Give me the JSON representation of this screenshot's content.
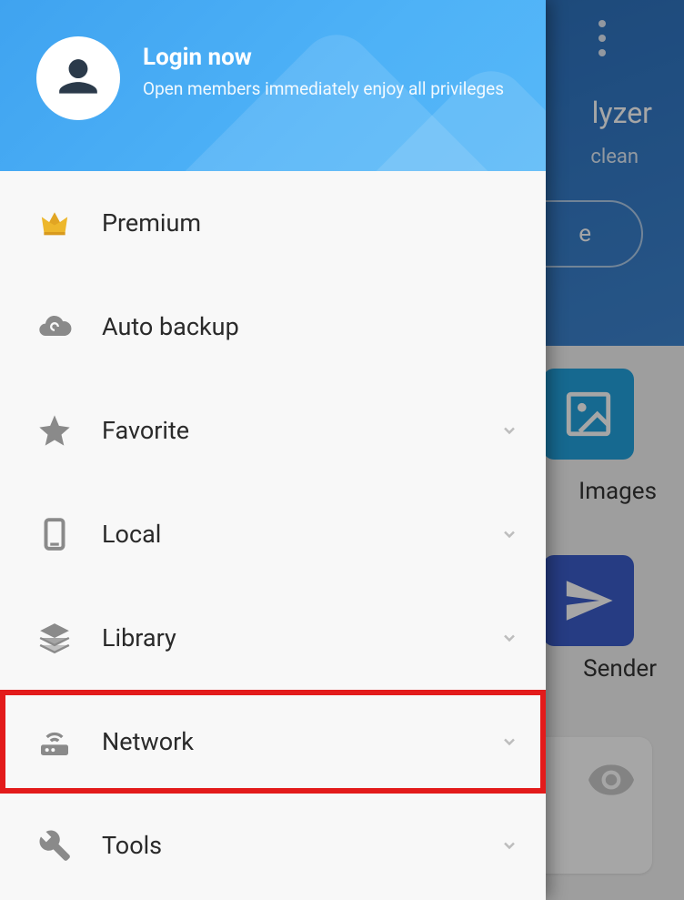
{
  "drawer": {
    "login_title": "Login now",
    "login_subtitle": "Open members immediately enjoy all privileges",
    "items": [
      {
        "label": "Premium",
        "icon": "crown-icon",
        "expandable": false
      },
      {
        "label": "Auto backup",
        "icon": "cloud-icon",
        "expandable": false
      },
      {
        "label": "Favorite",
        "icon": "star-icon",
        "expandable": true
      },
      {
        "label": "Local",
        "icon": "phone-icon",
        "expandable": true
      },
      {
        "label": "Library",
        "icon": "layers-icon",
        "expandable": true
      },
      {
        "label": "Network",
        "icon": "router-icon",
        "expandable": true,
        "highlight": true
      },
      {
        "label": "Tools",
        "icon": "wrench-icon",
        "expandable": true
      }
    ]
  },
  "background": {
    "title_fragment": "lyzer",
    "subtitle_fragment": "clean",
    "pill_button_fragment": "e",
    "tiles": [
      {
        "label_fragment": "Images"
      },
      {
        "label_fragment": "Sender"
      }
    ]
  },
  "colors": {
    "drawer_header": "#4eb2f7",
    "highlight_box": "#e31b1b",
    "icon_gray": "#8a8a8a",
    "crown_gold": "#edb72c"
  }
}
